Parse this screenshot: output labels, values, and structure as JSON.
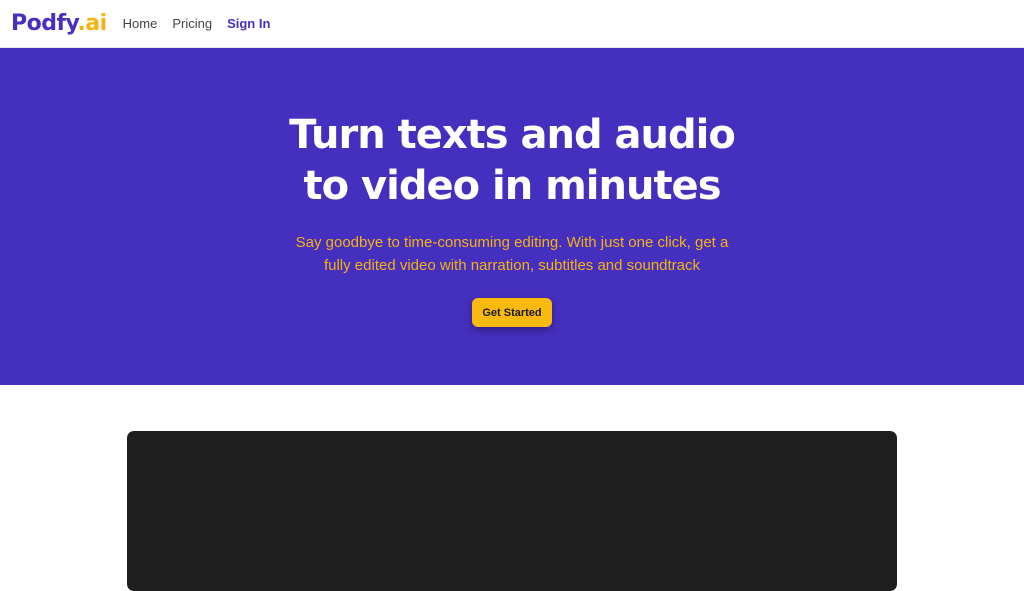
{
  "brand": {
    "name_main": "Podfy",
    "name_suffix": ".ai",
    "color_primary": "#4530c0",
    "color_accent": "#f5b312"
  },
  "nav": {
    "items": [
      {
        "label": "Home"
      },
      {
        "label": "Pricing"
      }
    ],
    "signin_label": "Sign In"
  },
  "hero": {
    "title_line1": "Turn texts and audio",
    "title_line2": "to video in minutes",
    "subtitle_line1": "Say goodbye to time-consuming editing. With just one click, get a",
    "subtitle_line2": "fully edited video with narration, subtitles and soundtrack",
    "cta_label": "Get Started",
    "background_color": "#452fbe"
  },
  "video_panel": {
    "background_color": "#1e1e1e"
  }
}
